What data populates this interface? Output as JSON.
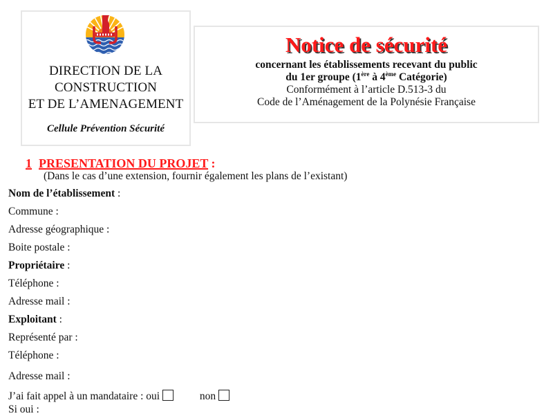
{
  "header": {
    "organization": {
      "logo_icon": "polynesia-coat-of-arms",
      "lines": [
        "DIRECTION DE LA",
        "CONSTRUCTION",
        "ET DE L’AMENAGEMENT"
      ],
      "unit": "Cellule Prévention Sécurité"
    },
    "notice": {
      "title": "Notice de sécurité",
      "subtitle_line1": "concernant les établissements recevant du public",
      "subtitle_line2_prefix": "du 1er groupe (1",
      "sup1": "ère",
      "subtitle_line2_mid": " à 4",
      "sup2": "ème",
      "subtitle_line2_suffix": " Catégorie)",
      "reference_line1": "Conformément à l’article D.513-3 du",
      "reference_line2": "Code de l’Aménagement de la Polynésie Française"
    },
    "colors": {
      "title_red": "#ff1a1a",
      "border_gray": "#e6e6e6"
    }
  },
  "section1": {
    "number": "1",
    "title": "PRESENTATION DU PROJET",
    "title_suffix": " :",
    "note": "(Dans le cas d’une extension, fournir également les plans de l’existant)",
    "fields": [
      {
        "label": "Nom de l’établissement",
        "bold": true,
        "suffix": " :"
      },
      {
        "label": "Commune :",
        "bold": false,
        "suffix": ""
      },
      {
        "label": "Adresse géographique :",
        "bold": false,
        "suffix": ""
      },
      {
        "label": "Boite postale :",
        "bold": false,
        "suffix": ""
      },
      {
        "label": "Propriétaire",
        "bold": true,
        "suffix": " :"
      },
      {
        "label": "Téléphone :",
        "bold": false,
        "suffix": ""
      },
      {
        "label": "Adresse mail :",
        "bold": false,
        "suffix": ""
      },
      {
        "label": "Exploitant",
        "bold": true,
        "suffix": " :"
      },
      {
        "label": "Représenté par :",
        "bold": false,
        "suffix": ""
      },
      {
        "label": "Téléphone :",
        "bold": false,
        "suffix": ""
      },
      {
        "label": "Adresse mail :",
        "bold": false,
        "suffix": ""
      }
    ],
    "mandataire": {
      "question": "J’ai fait appel à un mandataire :",
      "option_yes": "oui",
      "option_no": "non",
      "yes_checked": false,
      "no_checked": false
    },
    "si_oui": "Si oui :"
  }
}
